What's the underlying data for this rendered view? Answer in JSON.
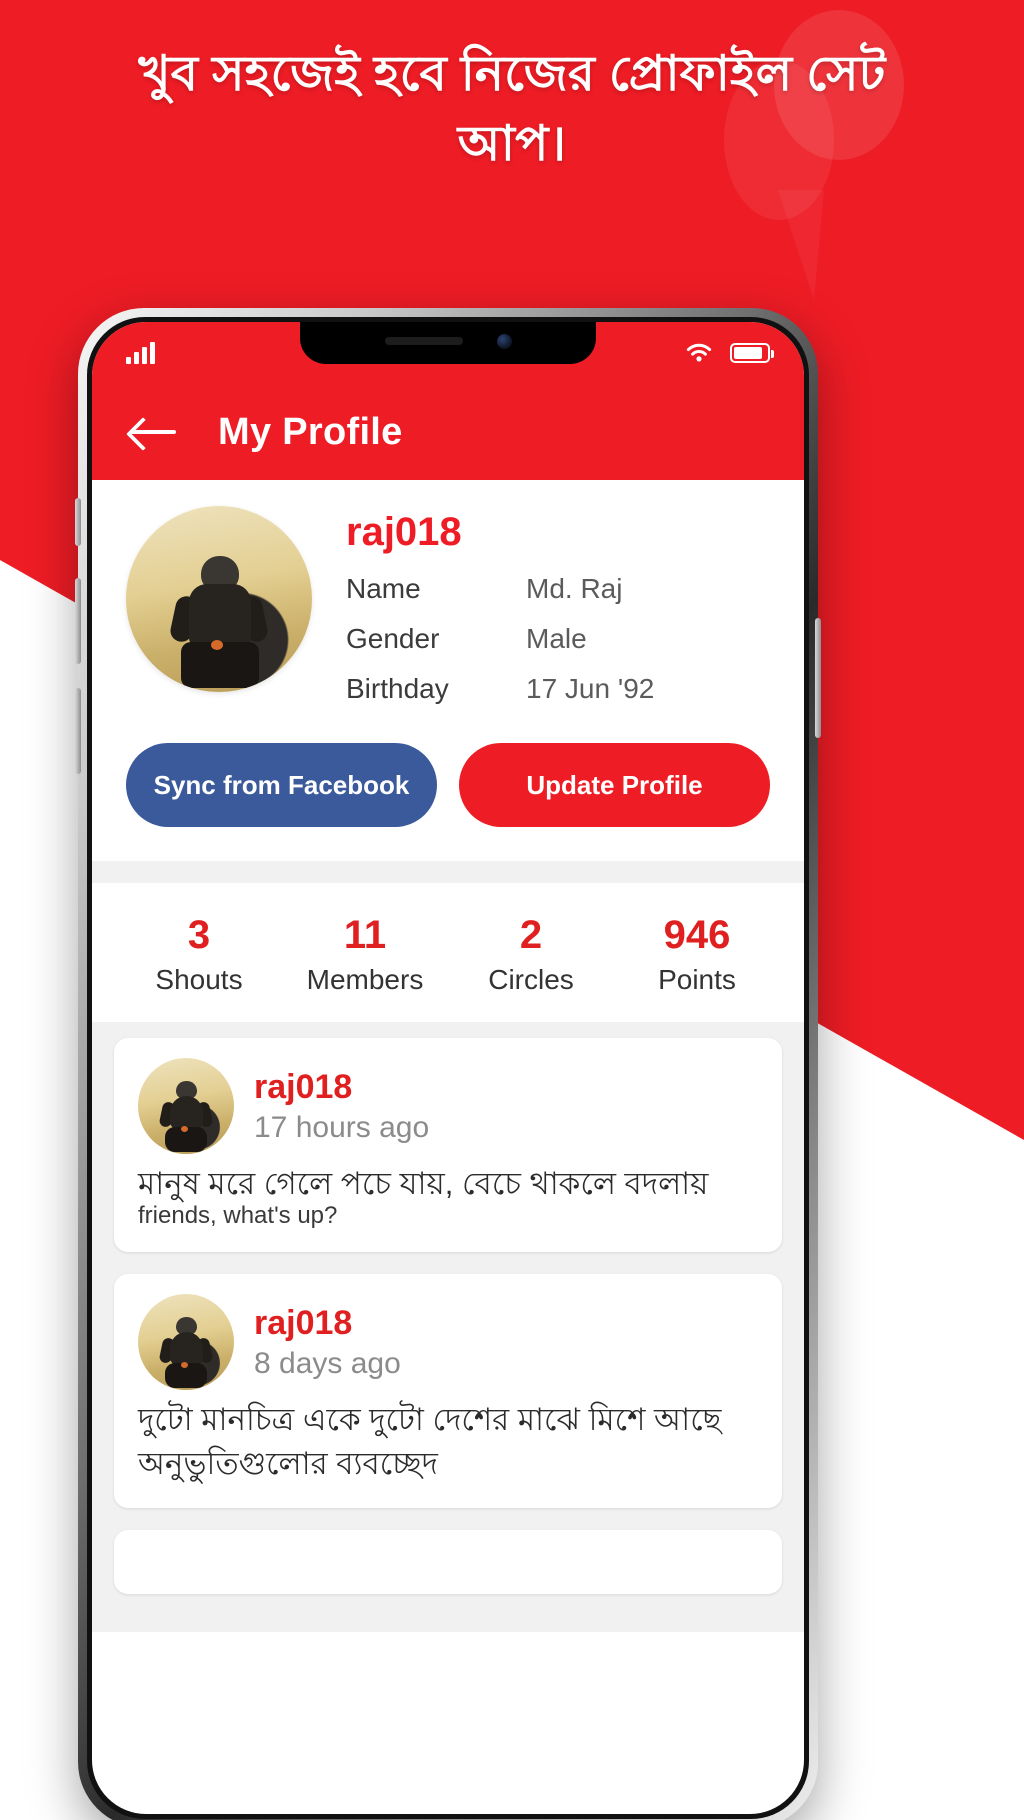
{
  "promo": {
    "headline": "খুব সহজেই হবে নিজের প্রোফাইল সেট আপ।",
    "background_color": "#ee1c25"
  },
  "status_bar": {
    "signal_icon": "signal-bars-icon",
    "wifi_icon": "wifi-icon",
    "battery_icon": "battery-icon"
  },
  "app_bar": {
    "back_icon": "back-arrow-icon",
    "title": "My Profile",
    "color": "#ee1c25"
  },
  "profile": {
    "avatar_icon": "motorcycle-rider-avatar",
    "username": "raj018",
    "username_color": "#ee1c25",
    "fields": [
      {
        "label": "Name",
        "value": "Md. Raj"
      },
      {
        "label": "Gender",
        "value": "Male"
      },
      {
        "label": "Birthday",
        "value": "17 Jun '92"
      }
    ],
    "buttons": {
      "sync_facebook": "Sync from Facebook",
      "sync_facebook_color": "#3b5a9b",
      "update_profile": "Update Profile",
      "update_profile_color": "#ee1c25"
    }
  },
  "stats": [
    {
      "value": "3",
      "label": "Shouts"
    },
    {
      "value": "11",
      "label": "Members"
    },
    {
      "value": "2",
      "label": "Circles"
    },
    {
      "value": "946",
      "label": "Points"
    }
  ],
  "stats_color": "#e02020",
  "feed": [
    {
      "avatar_icon": "motorcycle-rider-avatar",
      "user": "raj018",
      "time": "17 hours ago",
      "body": "মানুষ মরে গেলে পচে যায়, বেচে থাকলে বদলায়",
      "sub": "friends, what's up?"
    },
    {
      "avatar_icon": "motorcycle-rider-avatar",
      "user": "raj018",
      "time": "8 days ago",
      "body": "দুটো মানচিত্র একে দুটো দেশের মাঝে মিশে আছে অনুভুতিগুলোর ব্যবচ্ছেদ",
      "sub": ""
    }
  ]
}
